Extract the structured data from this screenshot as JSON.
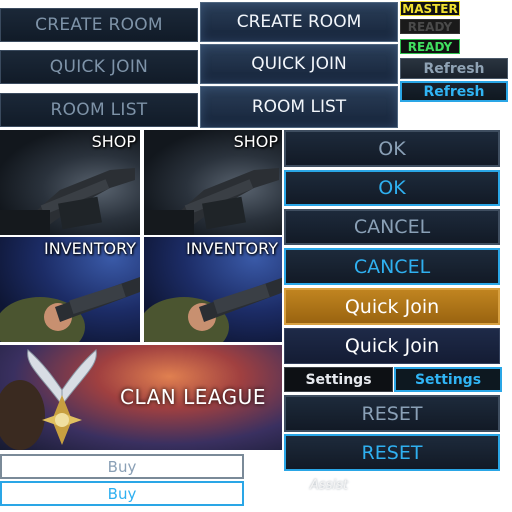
{
  "room_buttons": {
    "create_room": "CREATE ROOM",
    "quick_join": "QUICK JOIN",
    "room_list": "ROOM LIST"
  },
  "status_tags": {
    "master": "MASTER",
    "ready_dim": "READY",
    "ready_active": "READY"
  },
  "refresh": {
    "normal": "Refresh",
    "hover": "Refresh"
  },
  "tiles": {
    "shop": "SHOP",
    "inventory": "INVENTORY",
    "clan_league": "CLAN LEAGUE"
  },
  "right_buttons": {
    "ok": "OK",
    "cancel": "CANCEL",
    "quick_join": "Quick Join",
    "settings": "Settings",
    "reset": "RESET"
  },
  "buy": "Buy",
  "assist": "Assist",
  "colors": {
    "accent_blue": "#2aa6e6",
    "gold": "#b07818",
    "master_yellow": "#f0e030",
    "ready_green": "#40e060"
  }
}
